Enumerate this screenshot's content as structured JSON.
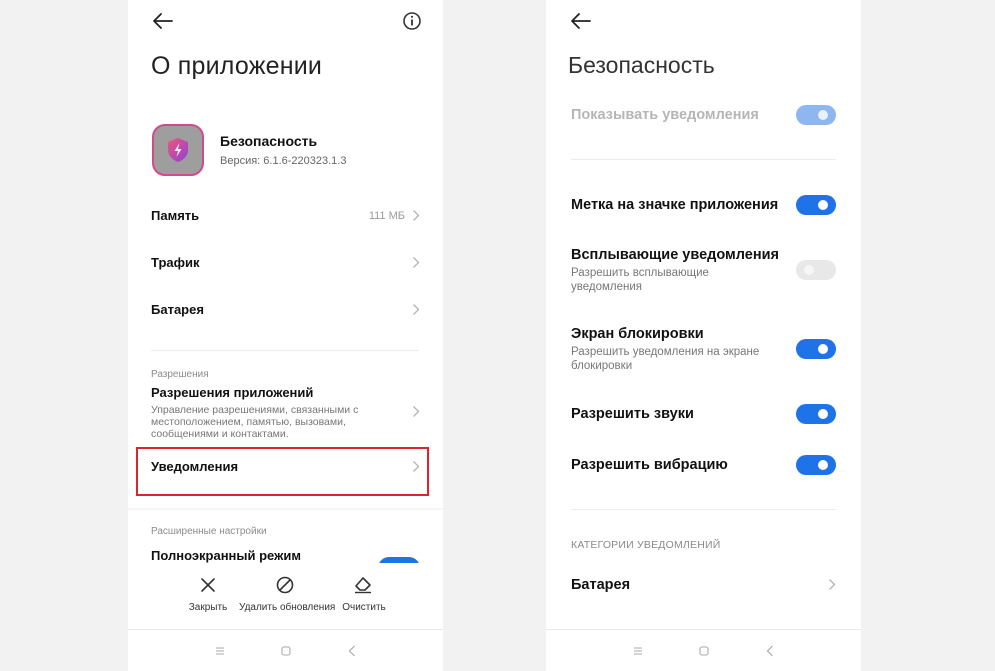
{
  "left": {
    "title": "О приложении",
    "app": {
      "name": "Безопасность",
      "version": "Версия: 6.1.6-220323.1.3"
    },
    "rows": [
      {
        "label": "Память",
        "value": "111 МБ"
      },
      {
        "label": "Трафик"
      },
      {
        "label": "Батарея"
      }
    ],
    "permissions_section": "Разрешения",
    "app_permissions": {
      "label": "Разрешения приложений",
      "desc": "Управление разрешениями, связанными с местоположением, памятью, вызовами, сообщениями и контактами."
    },
    "notifications": "Уведомления",
    "advanced_section": "Расширенные настройки",
    "fullscreen": "Полноэкранный режим",
    "actions": {
      "close": "Закрыть",
      "uninstall_updates": "Удалить обновления",
      "clear": "Очистить"
    },
    "highlight_color": "#d8262b"
  },
  "right": {
    "title": "Безопасность",
    "show_notifications": {
      "label": "Показывать уведомления",
      "on": true,
      "disabled": true
    },
    "badge": {
      "label": "Метка на значке приложения",
      "on": true
    },
    "floating": {
      "label": "Всплывающие уведомления",
      "desc": "Разрешить всплывающие уведомления",
      "on": false
    },
    "lockscreen": {
      "label": "Экран блокировки",
      "desc": "Разрешить уведомления на экране блокировки",
      "on": true
    },
    "sounds": {
      "label": "Разрешить звуки",
      "on": true
    },
    "vibration": {
      "label": "Разрешить вибрацию",
      "on": true
    },
    "categories_section": "КАТЕГОРИИ УВЕДОМЛЕНИЙ",
    "battery": "Батарея",
    "accent_color": "#1f73e8"
  },
  "icons": {
    "back": "arrow-left-icon",
    "info": "info-icon",
    "chevron": "chevron-right-icon",
    "close": "x-icon",
    "uninstall": "circle-slash-icon",
    "clear": "eraser-icon",
    "nav_menu": "menu-icon",
    "nav_home": "square-icon",
    "nav_back": "chevron-left-icon"
  }
}
